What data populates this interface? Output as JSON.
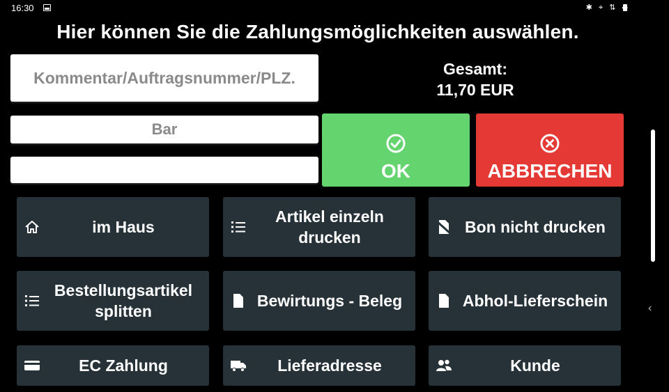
{
  "status_bar": {
    "time": "16:30",
    "icons": [
      "bluetooth-icon",
      "location-icon",
      "data-icon",
      "wifi-icon",
      "battery-icon"
    ]
  },
  "title": "Hier können Sie die Zahlungsmöglichkeiten auswählen.",
  "comment_field": {
    "placeholder": "Kommentar/Auftragsnummer/PLZ."
  },
  "payment_method_field": {
    "value": "Bar"
  },
  "amount_field": {
    "value": ""
  },
  "total": {
    "label": "Gesamt:",
    "amount": "11,70 EUR"
  },
  "actions": {
    "ok": {
      "label": "OK",
      "icon": "check-circle-icon",
      "color": "#64d46f"
    },
    "cancel": {
      "label": "ABBRECHEN",
      "icon": "x-circle-icon",
      "color": "#e53935"
    }
  },
  "options": [
    {
      "label": "im Haus",
      "icon": "home-icon"
    },
    {
      "label": "Artikel einzeln drucken",
      "icon": "numbered-list-icon"
    },
    {
      "label": "Bon nicht drucken",
      "icon": "no-document-icon"
    },
    {
      "label": "Bestellungsartikel splitten",
      "icon": "numbered-list-icon"
    },
    {
      "label": "Bewirtungs - Beleg",
      "icon": "document-icon"
    },
    {
      "label": "Abhol-Lieferschein",
      "icon": "document-icon"
    },
    {
      "label": "EC Zahlung",
      "icon": "credit-card-icon"
    },
    {
      "label": "Lieferadresse",
      "icon": "truck-icon"
    },
    {
      "label": "Kunde",
      "icon": "users-icon"
    }
  ],
  "colors": {
    "tile_bg": "#263238",
    "background": "#000000"
  }
}
